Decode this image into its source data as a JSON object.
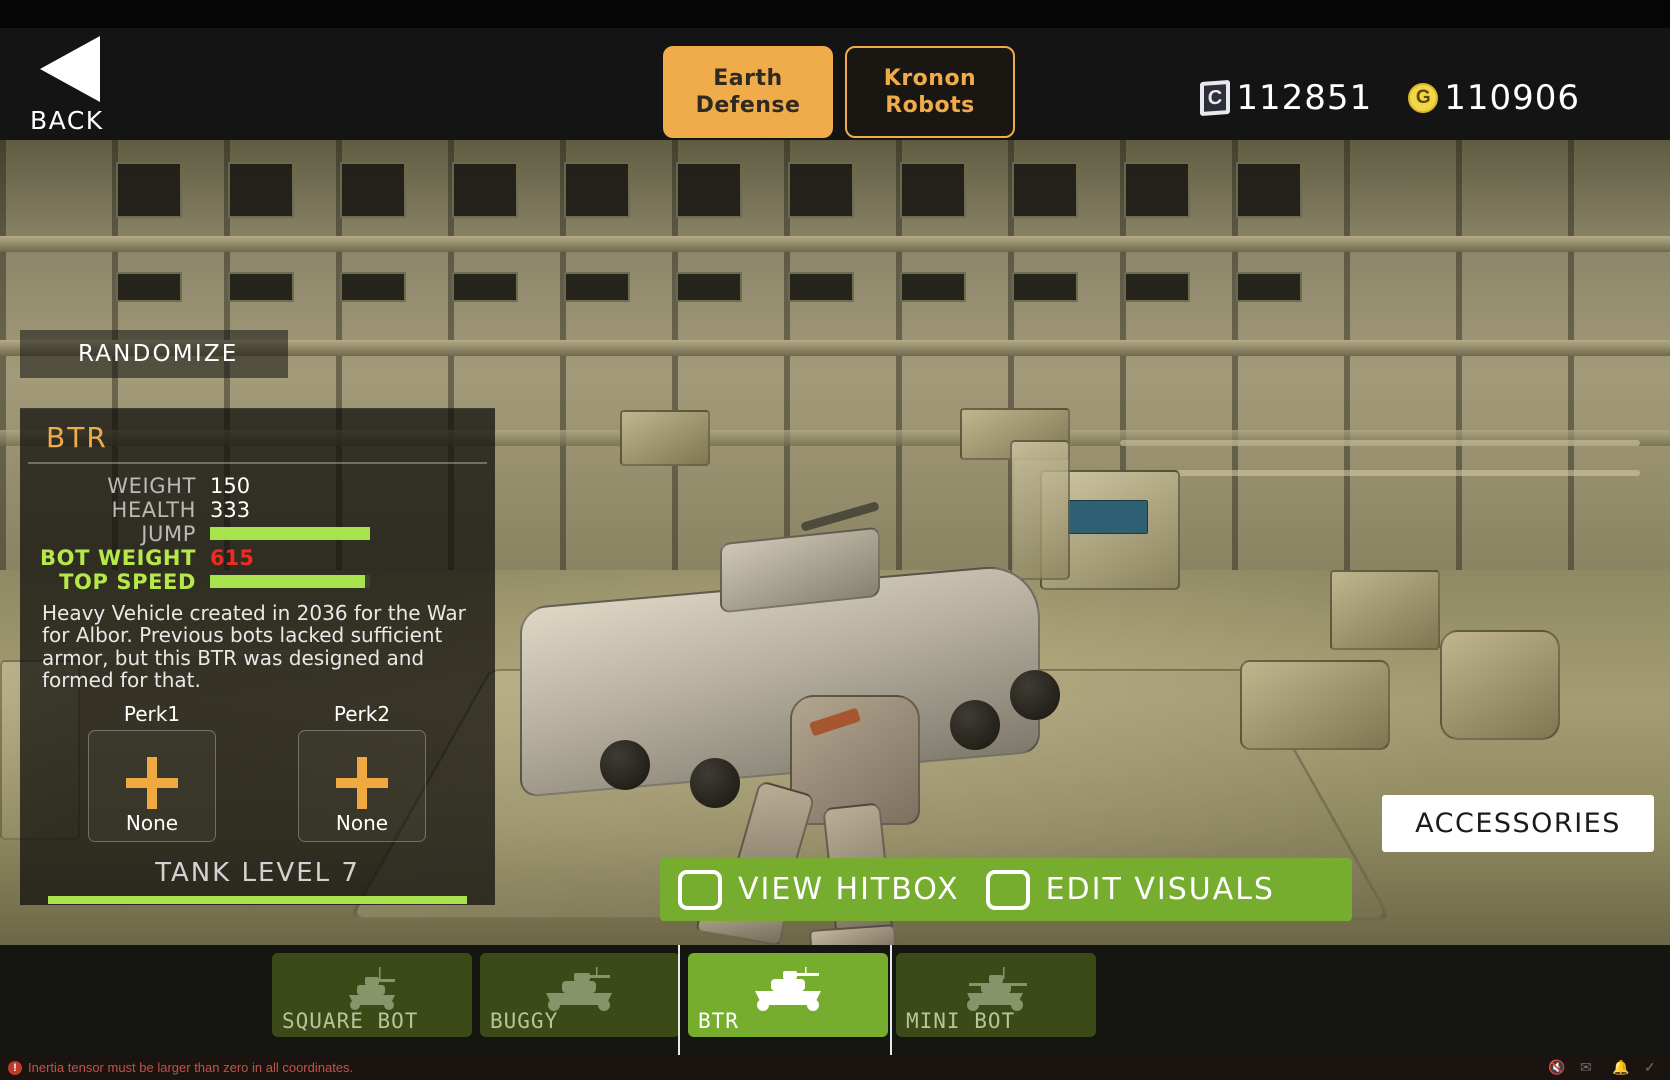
{
  "header": {
    "back_label": "BACK",
    "back_icon": "triangle-left-icon",
    "tabs": [
      {
        "label": "Earth\nDefense",
        "active": true
      },
      {
        "label": "Kronon\nRobots",
        "active": false
      }
    ],
    "currencies": [
      {
        "icon": "card-credit-icon",
        "symbol": "C",
        "value": "112851"
      },
      {
        "icon": "gold-coin-icon",
        "symbol": "G",
        "value": "110906"
      }
    ],
    "accent_active": "#f0ab4a",
    "accent_inactive_bg": "#1a1713"
  },
  "panel": {
    "randomize_label": "RANDOMIZE",
    "bot_name": "BTR",
    "stats": [
      {
        "label": "WEIGHT",
        "type": "number",
        "value": "150",
        "highlight": false,
        "danger": false
      },
      {
        "label": "HEALTH",
        "type": "number",
        "value": "333",
        "highlight": false,
        "danger": false
      },
      {
        "label": "JUMP",
        "type": "bar",
        "value": "100",
        "highlight": false,
        "danger": false
      },
      {
        "label": "BOT WEIGHT",
        "type": "number",
        "value": "615",
        "highlight": true,
        "danger": true
      },
      {
        "label": "TOP SPEED",
        "type": "bar",
        "value": "97",
        "highlight": true,
        "danger": false
      }
    ],
    "description": "Heavy Vehicle created in 2036 for the War for Albor. Previous bots lacked sufficient armor, but this BTR was designed and formed for that.",
    "perks": [
      {
        "title": "Perk1",
        "value": "None",
        "icon": "plus-icon"
      },
      {
        "title": "Perk2",
        "value": "None",
        "icon": "plus-icon"
      }
    ],
    "tank_level_label": "TANK LEVEL 7",
    "tank_level_progress": "100"
  },
  "actions": {
    "view_hitbox_label": "VIEW HITBOX",
    "view_hitbox_checked": false,
    "edit_visuals_label": "EDIT VISUALS",
    "edit_visuals_checked": false,
    "accessories_label": "ACCESSORIES",
    "button_color": "#76ad2e"
  },
  "vehicles": [
    {
      "name": "SQUARE BOT",
      "selected": false,
      "icon": "tank-silhouette-icon"
    },
    {
      "name": "BUGGY",
      "selected": false,
      "icon": "tank-silhouette-icon"
    },
    {
      "name": "BTR",
      "selected": true,
      "icon": "tank-silhouette-icon"
    },
    {
      "name": "MINI BOT",
      "selected": false,
      "icon": "tank-silhouette-icon"
    }
  ],
  "status": {
    "error_icon": "warning-icon",
    "error_text": "Inertia tensor must be larger than zero in all coordinates.",
    "right_icons": [
      "mute-icon",
      "message-icon",
      "bell-icon",
      "check-icon"
    ]
  }
}
